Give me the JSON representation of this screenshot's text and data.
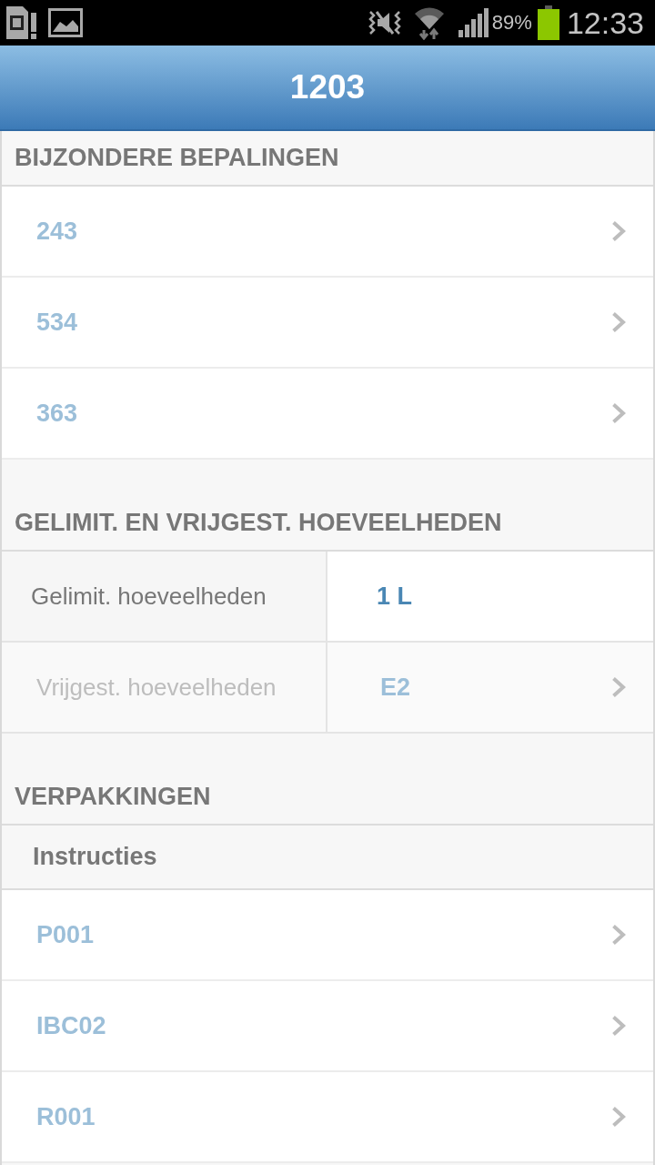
{
  "status_bar": {
    "battery": "89%",
    "time": "12:33"
  },
  "header": {
    "title": "1203"
  },
  "sections": [
    {
      "title": "BIJZONDERE BEPALINGEN",
      "kind": "list",
      "items": [
        {
          "label": "243"
        },
        {
          "label": "534"
        },
        {
          "label": "363"
        }
      ]
    },
    {
      "title": "GELIMIT. EN VRIJGEST. HOEVEELHEDEN",
      "kind": "table",
      "rows": [
        {
          "label": "Gelimit. hoeveelheden",
          "value": "1 L",
          "kind": "value"
        },
        {
          "label": "Vrijgest. hoeveelheden",
          "value": "E2",
          "kind": "link"
        }
      ]
    },
    {
      "title": "VERPAKKINGEN",
      "kind": "list",
      "subtitle": "Instructies",
      "items": [
        {
          "label": "P001"
        },
        {
          "label": "IBC02"
        },
        {
          "label": "R001"
        }
      ]
    }
  ]
}
